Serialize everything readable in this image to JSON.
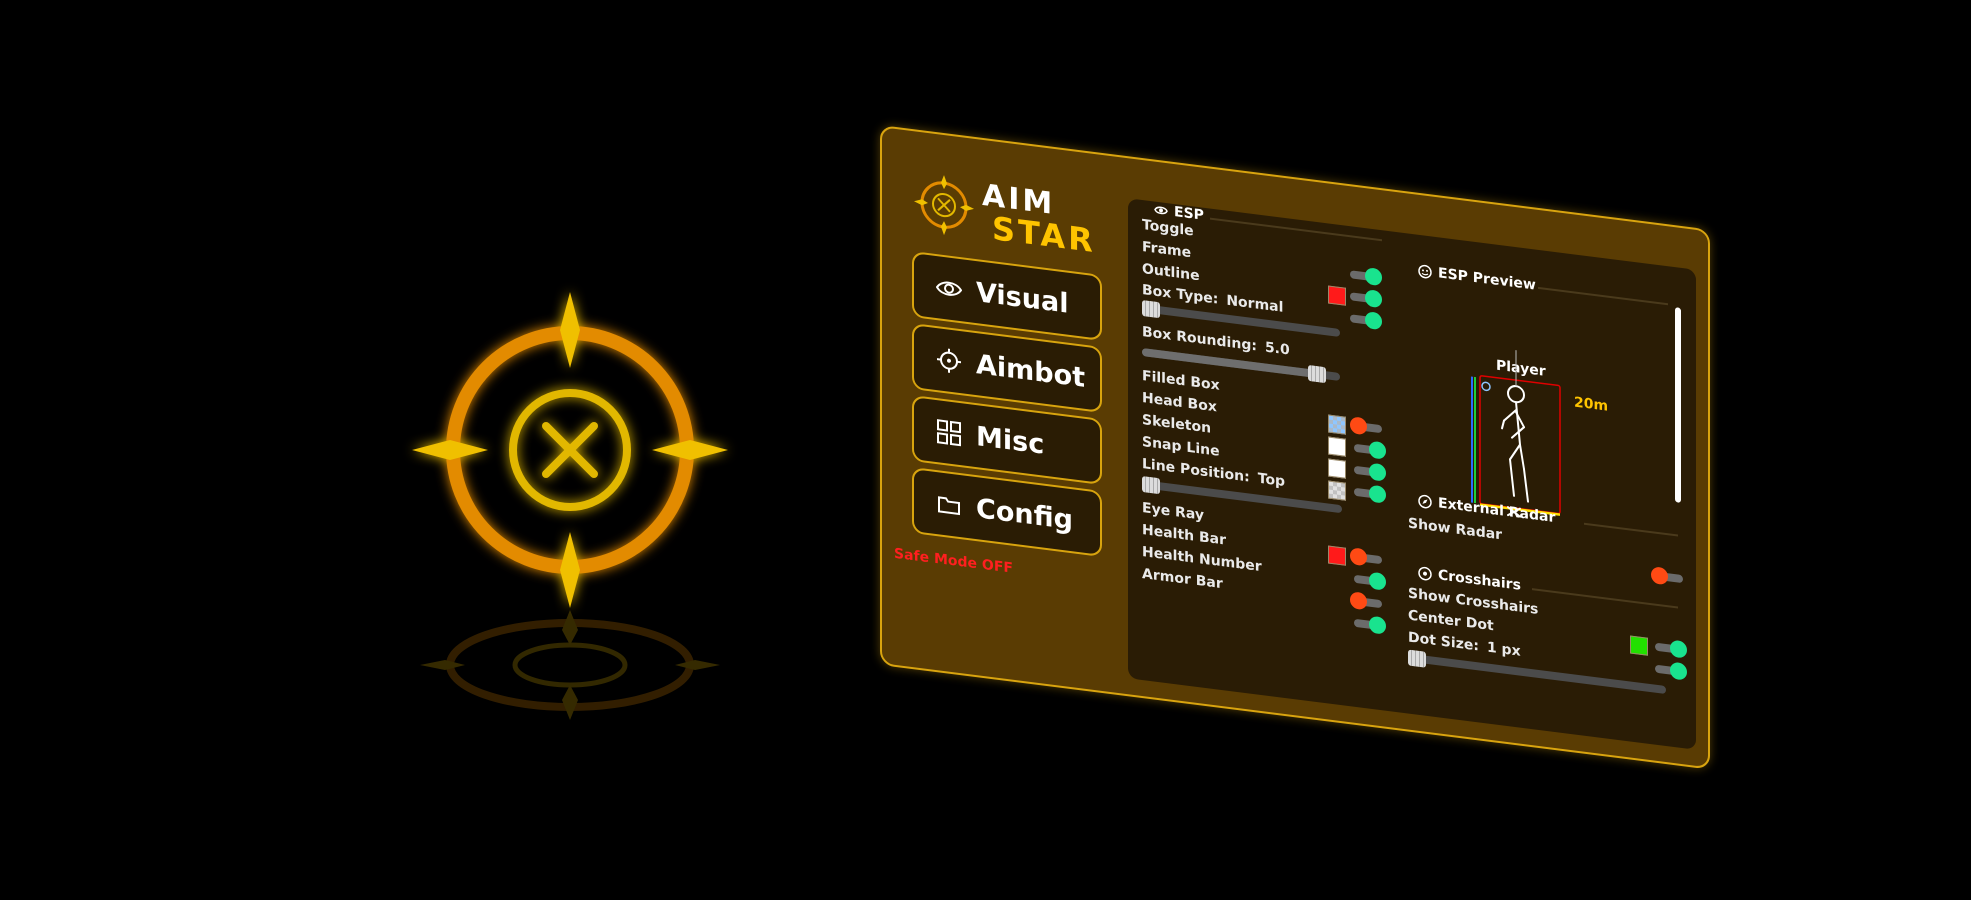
{
  "brand": {
    "word1": "AIM",
    "word2": "STAR",
    "logo_icon": "crosshair-logo-icon",
    "accent_color": "#ffc400",
    "border_color": "#d9a40f"
  },
  "nav": {
    "items": [
      {
        "label": "Visual",
        "icon": "eye-icon"
      },
      {
        "label": "Aimbot",
        "icon": "crosshair-icon"
      },
      {
        "label": "Misc",
        "icon": "grid-icon"
      },
      {
        "label": "Config",
        "icon": "folder-icon"
      }
    ]
  },
  "status": {
    "safe_mode": "Safe Mode OFF",
    "safe_mode_color": "#ff1f1f"
  },
  "esp": {
    "header": "ESP",
    "header_icon": "eye-icon",
    "options": {
      "toggle": {
        "label": "Toggle",
        "enabled": true
      },
      "frame": {
        "label": "Frame",
        "enabled": true
      },
      "outline": {
        "label": "Outline",
        "enabled": true,
        "color": "#ff1a1a"
      },
      "box_type": {
        "label": "Box Type:",
        "value": "Normal",
        "slider_fraction": 0.0
      },
      "box_rounding": {
        "label": "Box Rounding:",
        "value": "5.0",
        "slider_fraction": 0.92
      },
      "filled_box": {
        "label": "Filled Box"
      },
      "head_box": {
        "label": "Head Box",
        "enabled": false,
        "color": "#8fc6ff"
      },
      "skeleton": {
        "label": "Skeleton",
        "enabled": true,
        "color": "#ffffff"
      },
      "snap_line": {
        "label": "Snap Line",
        "enabled": true,
        "color": "#ffffff"
      },
      "line_position": {
        "label": "Line Position:",
        "value": "Top",
        "slider_fraction": 0.0
      },
      "eye_ray": {
        "label": "Eye Ray",
        "enabled": true
      },
      "health_bar": {
        "label": "Health Bar",
        "enabled": false,
        "color": "#ff1a1a"
      },
      "health_number": {
        "label": "Health Number",
        "enabled": true
      },
      "armor_bar": {
        "label": "Armor Bar",
        "enabled": false
      }
    }
  },
  "preview": {
    "header": "ESP Preview",
    "header_icon": "smiley-icon",
    "player_name": "Player",
    "distance": "20m"
  },
  "radar": {
    "header": "External Radar",
    "header_icon": "compass-icon",
    "show_radar": {
      "label": "Show Radar",
      "enabled": false
    }
  },
  "crosshairs": {
    "header": "Crosshairs",
    "header_icon": "target-icon",
    "show_crosshairs": {
      "label": "Show Crosshairs",
      "enabled": true,
      "color": "#22e000"
    },
    "center_dot": {
      "label": "Center Dot",
      "enabled": true
    },
    "dot_size": {
      "label": "Dot Size:",
      "value": "1 px",
      "slider_fraction": 0.0
    }
  }
}
